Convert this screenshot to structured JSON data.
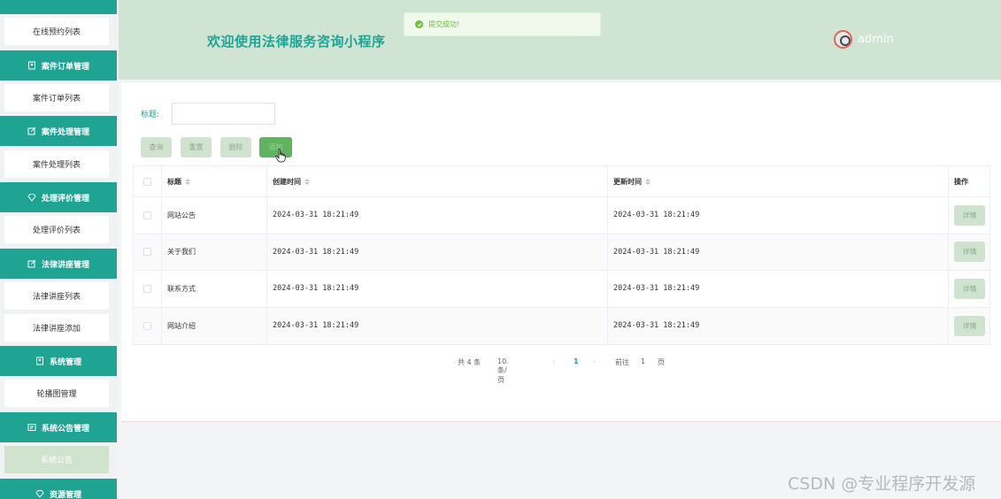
{
  "sidebar": {
    "items": [
      {
        "type": "item",
        "label": "在线预约列表"
      },
      {
        "type": "section",
        "label": "案件订单管理",
        "icon": "user-card-icon"
      },
      {
        "type": "item",
        "label": "案件订单列表"
      },
      {
        "type": "section",
        "label": "案件处理管理",
        "icon": "edit-icon"
      },
      {
        "type": "item",
        "label": "案件处理列表"
      },
      {
        "type": "section",
        "label": "处理评价管理",
        "icon": "diamond-icon"
      },
      {
        "type": "item",
        "label": "处理评价列表"
      },
      {
        "type": "section",
        "label": "法律讲座管理",
        "icon": "edit-icon"
      },
      {
        "type": "item",
        "label": "法律讲座列表"
      },
      {
        "type": "item",
        "label": "法律讲座添加"
      },
      {
        "type": "section",
        "label": "系统管理",
        "icon": "user-card-icon"
      },
      {
        "type": "item",
        "label": "轮播图管理"
      },
      {
        "type": "section",
        "label": "系统公告管理",
        "icon": "notice-icon"
      },
      {
        "type": "item",
        "label": "系统公告",
        "active": true
      },
      {
        "type": "section",
        "label": "资源管理",
        "icon": "diamond-icon"
      }
    ]
  },
  "header": {
    "title": "欢迎使用法律服务咨询小程序",
    "toast": "提交成功!",
    "username": "admin"
  },
  "search": {
    "label": "标题:",
    "value": "",
    "placeholder": ""
  },
  "toolbar": {
    "query_label": "查询",
    "reset_label": "重置",
    "delete_label": "删除",
    "add_label": "添加"
  },
  "table": {
    "columns": [
      "标题",
      "创建时间",
      "更新时间",
      "操作"
    ],
    "rows": [
      {
        "title": "网站公告",
        "created": "2024-03-31 18:21:49",
        "updated": "2024-03-31 18:21:49",
        "action": "详情"
      },
      {
        "title": "关于我们",
        "created": "2024-03-31 18:21:49",
        "updated": "2024-03-31 18:21:49",
        "action": "详情"
      },
      {
        "title": "联系方式",
        "created": "2024-03-31 18:21:49",
        "updated": "2024-03-31 18:21:49",
        "action": "详情"
      },
      {
        "title": "网站介绍",
        "created": "2024-03-31 18:21:49",
        "updated": "2024-03-31 18:21:49",
        "action": "详情"
      }
    ]
  },
  "pagination": {
    "total": "共 4 条",
    "page_size": "10条/页",
    "current_page": "1",
    "goto_label": "前往",
    "goto_value": "1",
    "page_suffix": "页"
  },
  "watermark": "CSDN @专业程序开发源",
  "colors": {
    "primary": "#1fa393",
    "header_bg": "#cfe4d2",
    "button_bg": "#cfe3cf",
    "success": "#67c23a"
  }
}
